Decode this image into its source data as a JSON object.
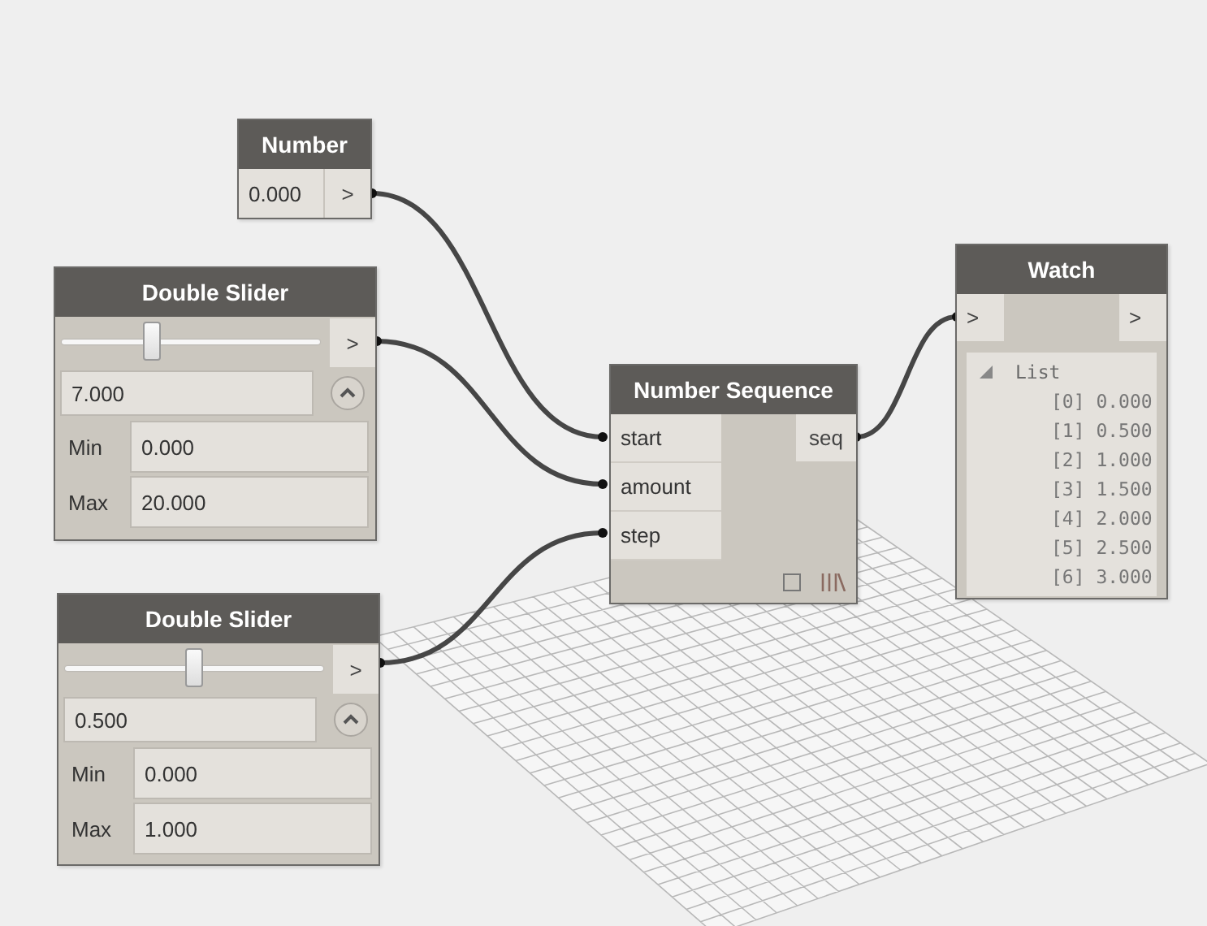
{
  "number_node": {
    "title": "Number",
    "value": "0.000",
    "output": ">"
  },
  "slider_nodes": [
    {
      "title": "Double Slider",
      "level": 0.35,
      "output": ">",
      "value": "7.000",
      "min_label": "Min",
      "min": "0.000",
      "max_label": "Max",
      "max": "20.000"
    },
    {
      "title": "Double Slider",
      "level": 0.5,
      "output": ">",
      "value": "0.500",
      "min_label": "Min",
      "min": "0.000",
      "max_label": "Max",
      "max": "1.000"
    }
  ],
  "sequence_node": {
    "title": "Number Sequence",
    "inputs": [
      "start",
      "amount",
      "step"
    ],
    "output": "seq"
  },
  "watch_node": {
    "title": "Watch",
    "input": ">",
    "output": ">",
    "list": {
      "label": "List",
      "expanded": true,
      "items": [
        "[0] 0.000",
        "[1] 0.500",
        "[2] 1.000",
        "[3] 1.500",
        "[4] 2.000",
        "[5] 2.500",
        "[6] 3.000"
      ]
    }
  }
}
